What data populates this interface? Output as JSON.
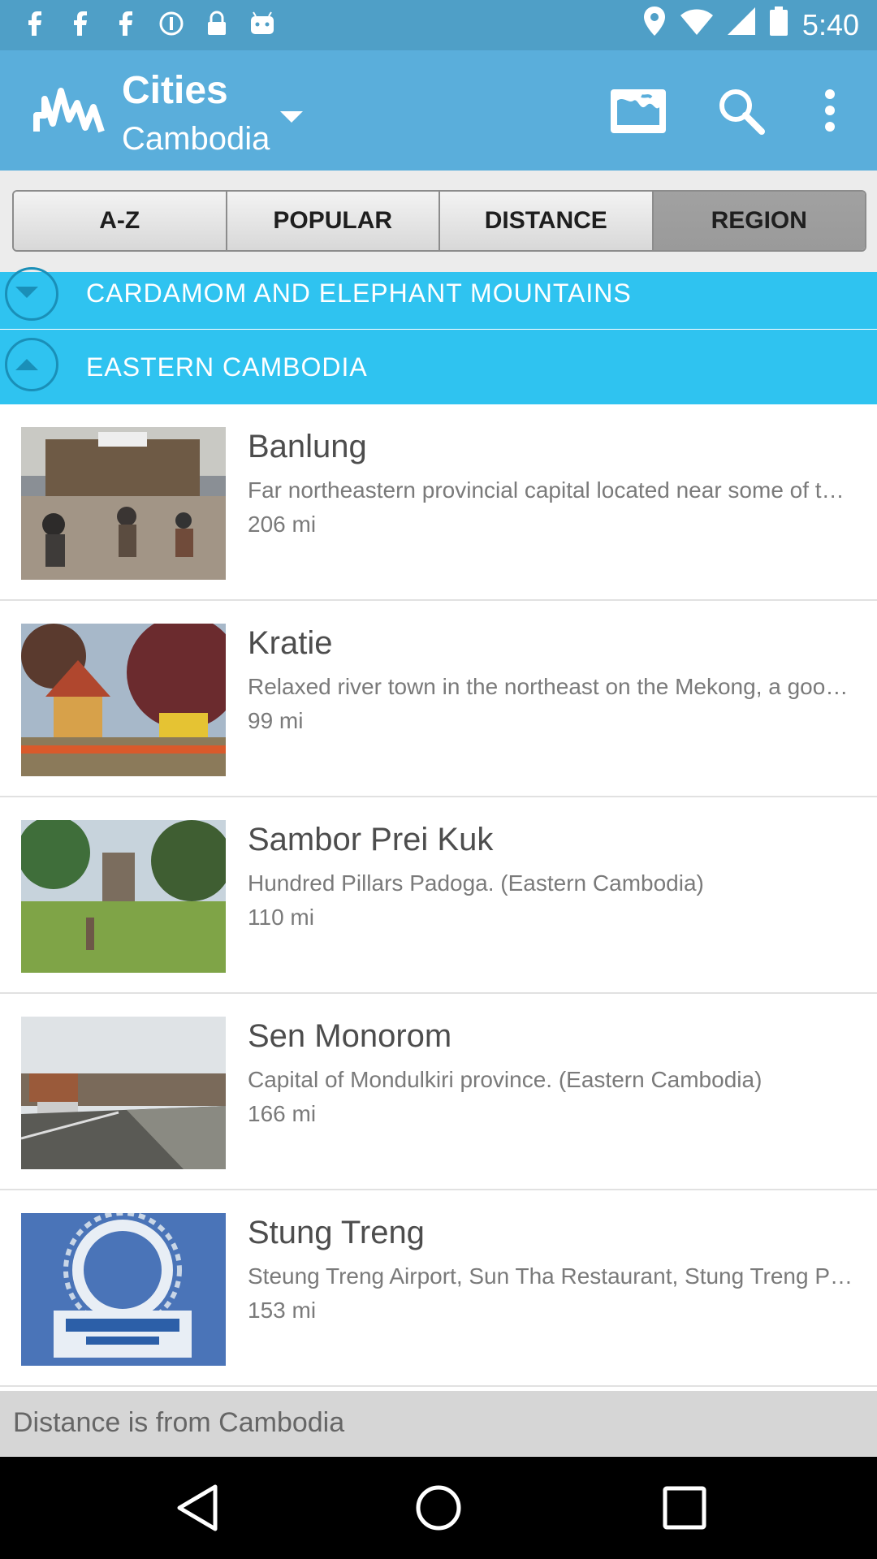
{
  "status_bar": {
    "time": "5:40",
    "left_icons": [
      "facebook-icon",
      "facebook-icon",
      "facebook-icon",
      "instagram-icon",
      "lock-icon",
      "android-icon"
    ],
    "right_icons": [
      "location-icon",
      "wifi-icon",
      "signal-icon",
      "battery-icon"
    ]
  },
  "header": {
    "title": "Cities",
    "subtitle": "Cambodia",
    "actions": [
      "map-icon",
      "search-icon",
      "more-vert-icon"
    ]
  },
  "tabs": [
    {
      "label": "A-Z",
      "active": false
    },
    {
      "label": "POPULAR",
      "active": false
    },
    {
      "label": "DISTANCE",
      "active": false
    },
    {
      "label": "REGION",
      "active": true
    }
  ],
  "sections": [
    {
      "label": "CARDAMOM AND ELEPHANT MOUNTAINS",
      "expanded": false
    },
    {
      "label": "EASTERN CAMBODIA",
      "expanded": true
    }
  ],
  "cities": [
    {
      "name": "Banlung",
      "description": "Far northeastern provincial capital located near some of the region's most beautiful scenery.",
      "distance": "206 mi"
    },
    {
      "name": "Kratie",
      "description": "Relaxed river town in the northeast on the Mekong, a good place to see Irrawaddy dolphins.",
      "distance": "99 mi"
    },
    {
      "name": "Sambor Prei Kuk",
      "description": "Hundred Pillars Padoga. (Eastern Cambodia)",
      "distance": "110 mi"
    },
    {
      "name": "Sen Monorom",
      "description": "Capital of Mondulkiri province. (Eastern Cambodia)",
      "distance": "166 mi"
    },
    {
      "name": "Stung Treng",
      "description": "Steung Treng Airport, Sun Tha Restaurant, Stung Treng Province",
      "distance": "153 mi"
    }
  ],
  "footer": {
    "text": "Distance is from Cambodia"
  },
  "nav_bar": {
    "buttons": [
      "back-icon",
      "home-icon",
      "recents-icon"
    ]
  }
}
